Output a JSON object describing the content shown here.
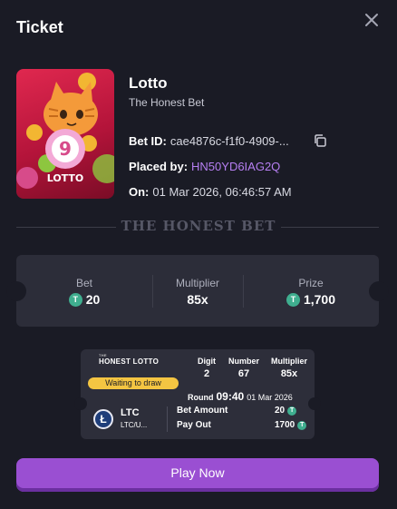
{
  "dialog": {
    "title": "Ticket"
  },
  "game": {
    "name": "Lotto",
    "subtitle": "The Honest Bet",
    "image_ball_number": "9",
    "image_label": "LOTTO"
  },
  "bet_info": {
    "bet_id_label": "Bet ID:",
    "bet_id_value": "cae4876c-f1f0-4909-...",
    "placed_by_label": "Placed by:",
    "placed_by_value": "HN50YD6IAG2Q",
    "on_label": "On:",
    "on_value": "01 Mar 2026, 06:46:57 AM"
  },
  "divider_text": "THE HONEST BET",
  "stats": {
    "bet_label": "Bet",
    "bet_value": "20",
    "multiplier_label": "Multiplier",
    "multiplier_value": "85x",
    "prize_label": "Prize",
    "prize_value": "1,700"
  },
  "ticket": {
    "brand": "HONEST LOTTO",
    "brand_tiny": "THE",
    "status": "Waiting to draw",
    "digit_label": "Digit",
    "digit_value": "2",
    "number_label": "Number",
    "number_value": "67",
    "multiplier_label": "Multiplier",
    "multiplier_value": "85x",
    "round_label": "Round",
    "round_time": "09:40",
    "round_date": "01 Mar 2026",
    "coin_name": "LTC",
    "coin_pair": "LTC/U...",
    "bet_amount_label": "Bet Amount",
    "bet_amount_value": "20",
    "payout_label": "Pay Out",
    "payout_value": "1700"
  },
  "play_button": "Play Now",
  "colors": {
    "background": "#1a1b25",
    "accent": "#9a4fd2",
    "link": "#b67ff2",
    "coin": "#3fae8f",
    "badge": "#f4c542"
  },
  "icons": [
    "close-icon",
    "copy-icon",
    "tether-icon",
    "litecoin-icon"
  ]
}
